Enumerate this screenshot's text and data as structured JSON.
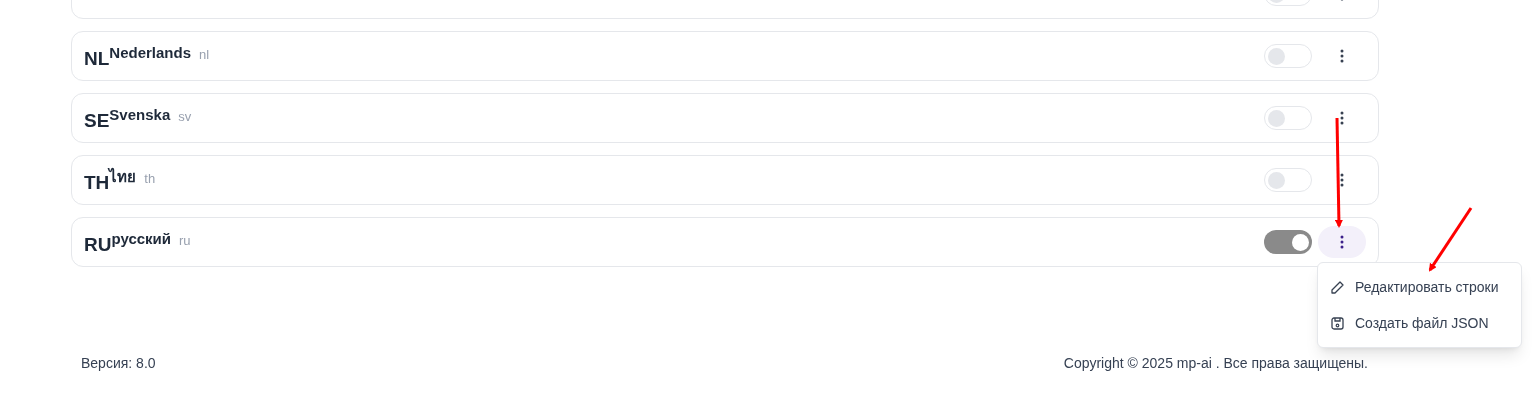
{
  "languages": [
    {
      "on": false,
      "menu_open": false
    },
    {
      "code": "NL",
      "name": "Nederlands",
      "locale": "nl",
      "on": false,
      "menu_open": false
    },
    {
      "code": "SE",
      "name": "Svenska",
      "locale": "sv",
      "on": false,
      "menu_open": false
    },
    {
      "code": "TH",
      "name": "ไทย",
      "locale": "th",
      "on": false,
      "menu_open": false
    },
    {
      "code": "RU",
      "name": "русский",
      "locale": "ru",
      "on": true,
      "menu_open": true
    }
  ],
  "menu": [
    {
      "kind": "edit",
      "label": "Редактировать строки"
    },
    {
      "kind": "save",
      "label": "Создать файл JSON"
    }
  ],
  "footer": {
    "version": "Версия: 8.0",
    "copyright": "Copyright © 2025 mp-ai . Все права защищены."
  }
}
